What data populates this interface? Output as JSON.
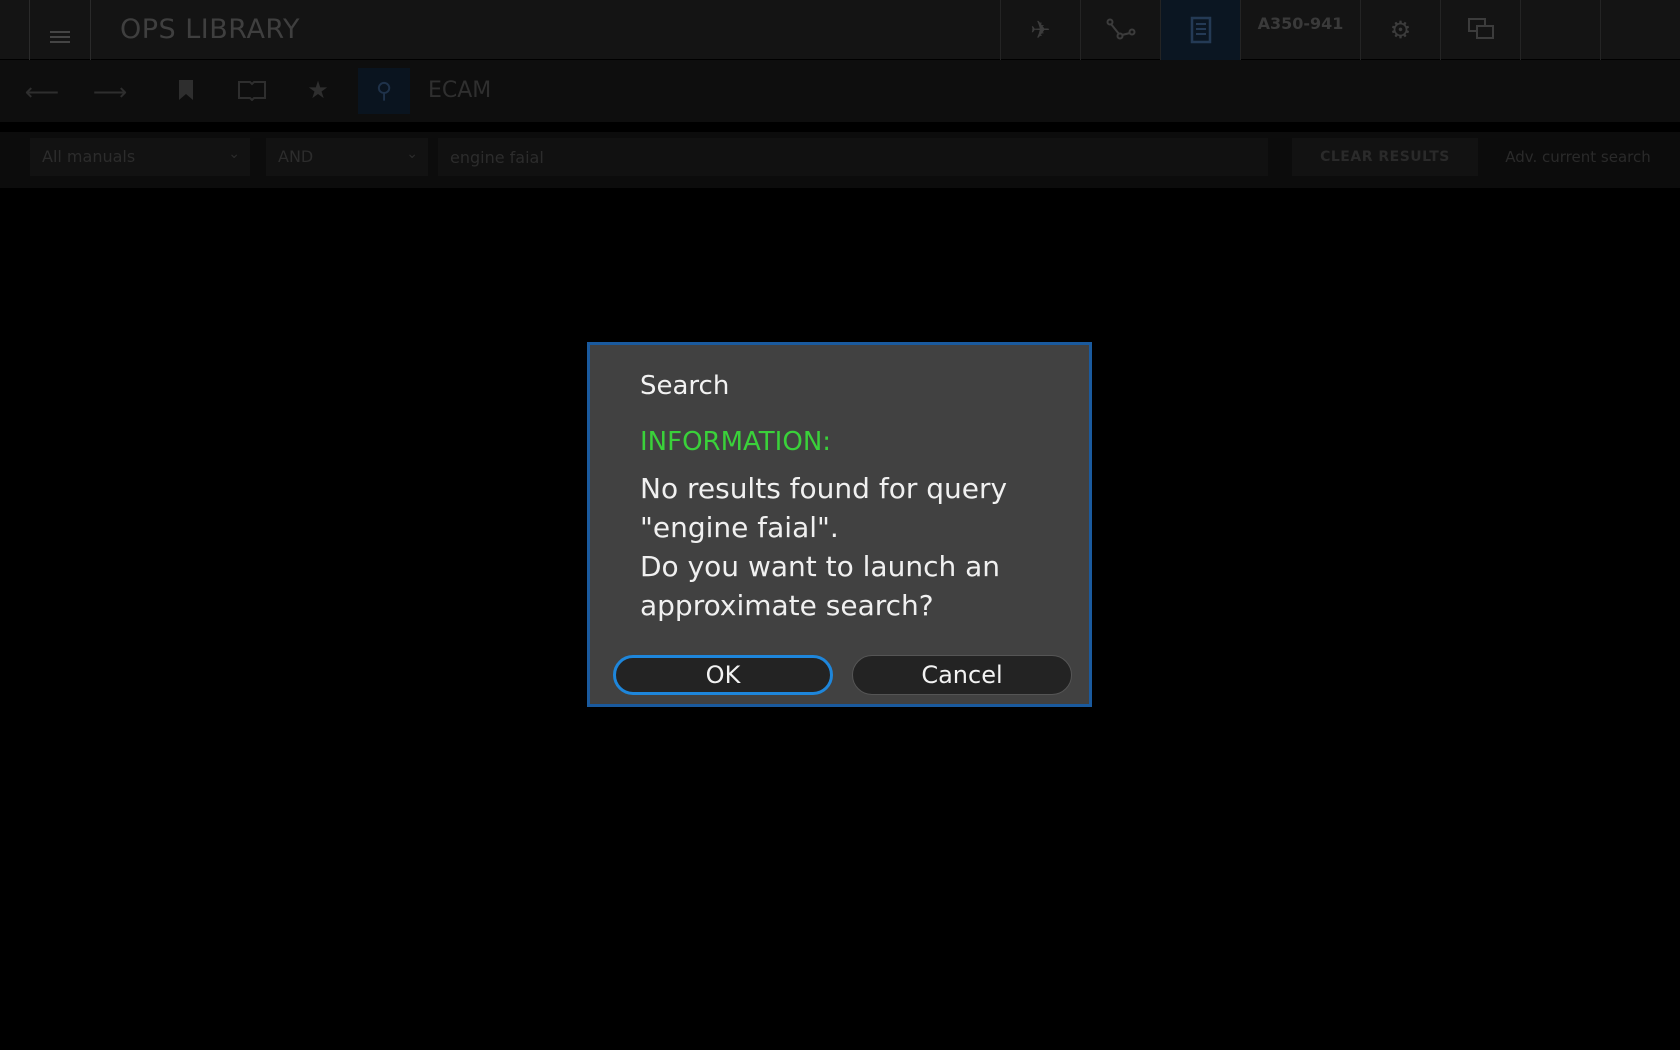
{
  "app": {
    "title": "OPS LIBRARY"
  },
  "topbar": {
    "tabs": [
      {
        "name": "aircraft-icon",
        "active": false
      },
      {
        "name": "route-icon",
        "active": false
      },
      {
        "name": "library-icon",
        "active": true
      },
      {
        "name": "aircraft-id",
        "label": "A350-941"
      },
      {
        "name": "gear-icon",
        "active": false
      },
      {
        "name": "messages-icon",
        "active": false
      }
    ]
  },
  "toolbar": {
    "title": "ECAM"
  },
  "search": {
    "manual_select": "All manuals",
    "operator_select": "AND",
    "query": "engine faial",
    "clear_label": "CLEAR RESULTS",
    "more_label": "Adv. current search"
  },
  "dialog": {
    "title": "Search",
    "info_label": "INFORMATION:",
    "message_line1": "No results found for query",
    "message_line2": "\"engine faial\".",
    "message_line3": "Do you want to launch an",
    "message_line4": "approximate search?",
    "ok_label": "OK",
    "cancel_label": "Cancel"
  },
  "colors": {
    "dialog_bg": "#414141",
    "dialog_border": "#1a5a9e",
    "info_green": "#3ad13a",
    "ok_focus": "#1e86db"
  }
}
